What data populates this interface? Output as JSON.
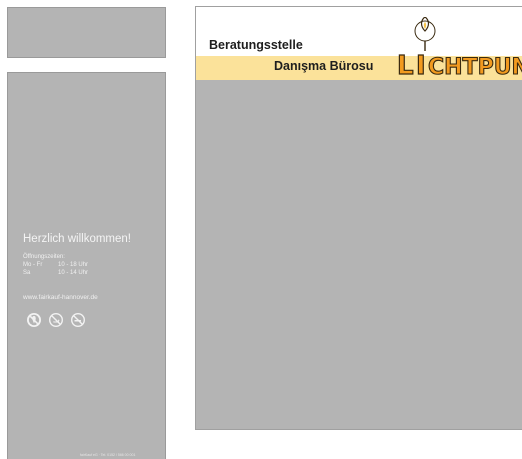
{
  "door": {
    "title": "Herzlich willkommen!",
    "hours_label": "Öffnungszeiten:",
    "hours": [
      {
        "days": "Mo - Fr",
        "time": "10 - 18 Uhr"
      },
      {
        "days": "Sa",
        "time": "10 - 14 Uhr"
      }
    ],
    "url": "www.fairkauf-hannover.de",
    "icons": [
      "no-ice-cream-icon",
      "no-dog-icon",
      "no-smoking-icon"
    ],
    "footer": "fairKauf eG · Tel. 0152 / 566 00 001"
  },
  "poster": {
    "title": "Beratungsstelle",
    "subtitle": "Danışma Bürosu",
    "logo_text": "LICHTPUNKT",
    "band_color": "#fbe29a",
    "logo_color": "#f29a1f"
  }
}
